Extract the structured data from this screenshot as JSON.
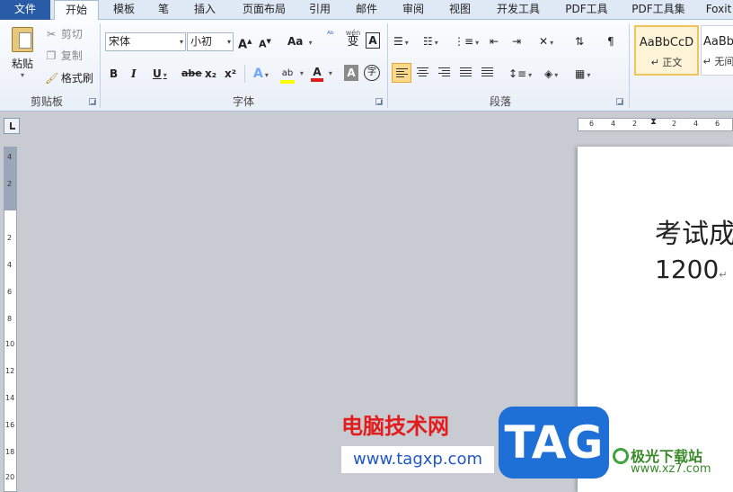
{
  "tabs": [
    {
      "label": "文件"
    },
    {
      "label": "开始"
    },
    {
      "label": "模板"
    },
    {
      "label": "笔"
    },
    {
      "label": "插入"
    },
    {
      "label": "页面布局"
    },
    {
      "label": "引用"
    },
    {
      "label": "邮件"
    },
    {
      "label": "审阅"
    },
    {
      "label": "视图"
    },
    {
      "label": "开发工具"
    },
    {
      "label": "PDF工具"
    },
    {
      "label": "PDF工具集"
    },
    {
      "label": "Foxit"
    }
  ],
  "clipboard": {
    "paste_label": "粘贴",
    "cut_label": "剪切",
    "copy_label": "复制",
    "format_painter_label": "格式刷",
    "group_label": "剪贴板"
  },
  "font": {
    "font_name": "宋体",
    "font_size": "小初",
    "grow_label": "A",
    "shrink_label": "A",
    "change_case_label": "Aa",
    "phonetic_label": "wén",
    "phonetic_char": "变",
    "border_label": "A",
    "bold": "B",
    "italic": "I",
    "underline": "U",
    "strike": "abe",
    "subscript": "x₂",
    "superscript": "x²",
    "font_color_label": "A",
    "shading_label": "A",
    "enclose_label": "字",
    "group_label": "字体"
  },
  "paragraph": {
    "group_label": "段落"
  },
  "styles": {
    "normal_sample": "AaBbCcD",
    "normal_name": "正文",
    "nospace_sample": "AaBb",
    "nospace_name": "无间"
  },
  "ruler": {
    "h_ticks": [
      "6",
      "4",
      "2",
      "2",
      "4",
      "6"
    ],
    "v_ticks": [
      "4",
      "2",
      "2",
      "4",
      "6",
      "8",
      "10",
      "12",
      "14",
      "16",
      "18",
      "20"
    ]
  },
  "document": {
    "line1": "考试成",
    "line2": "1200",
    "para_mark": "↵"
  },
  "watermark": {
    "site_name": "电脑技术网",
    "site_url": "www.tagxp.com",
    "tag_text": "TAG",
    "logo_name": "极光下载站",
    "logo_url": "www.xz7.com"
  },
  "colors": {
    "file_tab": "#2a5ba6",
    "ribbon_bg": "#fbfcfe",
    "doc_bg": "#c8ccd2",
    "font_color_bar": "#e21b1b",
    "highlight_bar": "#ffff00",
    "tag_blue": "#1e6fd6"
  }
}
